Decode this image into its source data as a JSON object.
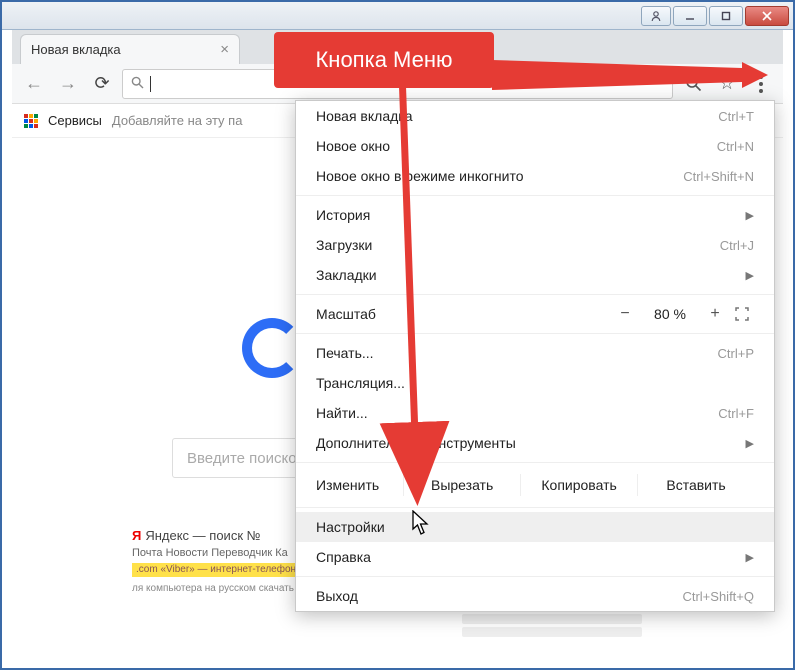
{
  "window": {
    "title": ""
  },
  "tab": {
    "title": "Новая вкладка"
  },
  "bookmarks": {
    "apps_label": "Сервисы",
    "hint": "Добавляйте на эту па"
  },
  "page": {
    "search_placeholder": "Введите поисков",
    "card1": {
      "title": "Яндекс — поиск №",
      "links": "Почта  Новости  Переводчик  Ка",
      "yellow": ".com  «Viber» — интернет-телефон",
      "grey": "ля компьютера на русском скачать бес"
    }
  },
  "callout": {
    "text": "Кнопка Меню"
  },
  "menu": {
    "new_tab": "Новая вкладка",
    "new_tab_sc": "Ctrl+T",
    "new_window": "Новое окно",
    "new_window_sc": "Ctrl+N",
    "incognito": "Новое окно в режиме инкогнито",
    "incognito_sc": "Ctrl+Shift+N",
    "history": "История",
    "downloads": "Загрузки",
    "downloads_sc": "Ctrl+J",
    "bookmarks": "Закладки",
    "zoom_label": "Масштаб",
    "zoom_minus": "−",
    "zoom_value": "80 %",
    "zoom_plus": "+",
    "print": "Печать...",
    "print_sc": "Ctrl+P",
    "cast": "Трансляция...",
    "find": "Найти...",
    "find_sc": "Ctrl+F",
    "more_tools": "Дополнительные инструменты",
    "edit_label": "Изменить",
    "cut": "Вырезать",
    "copy": "Копировать",
    "paste": "Вставить",
    "settings": "Настройки",
    "help": "Справка",
    "exit": "Выход",
    "exit_sc": "Ctrl+Shift+Q"
  }
}
